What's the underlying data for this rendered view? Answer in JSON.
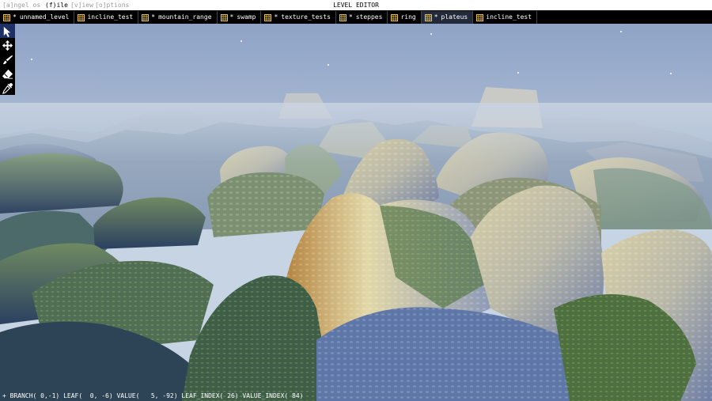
{
  "app": {
    "title": "LEVEL EDITOR"
  },
  "menu": {
    "items": [
      {
        "label": "[a]ngel os",
        "active": false
      },
      {
        "label": "(f)ile",
        "active": true
      },
      {
        "label": "[v]iew",
        "active": false
      },
      {
        "label": "[o]ptions",
        "active": false
      }
    ]
  },
  "tabs": [
    {
      "label": "unnamed_level",
      "dirty": true,
      "active": false
    },
    {
      "label": "incline_test",
      "dirty": false,
      "active": false
    },
    {
      "label": "mountain_range",
      "dirty": true,
      "active": false
    },
    {
      "label": "swamp",
      "dirty": true,
      "active": false
    },
    {
      "label": "texture_tests",
      "dirty": true,
      "active": false
    },
    {
      "label": "steppes",
      "dirty": true,
      "active": false
    },
    {
      "label": "ring",
      "dirty": false,
      "active": false
    },
    {
      "label": "plateus",
      "dirty": true,
      "active": true
    },
    {
      "label": "incline_test",
      "dirty": false,
      "active": false
    }
  ],
  "dirty_marker": "*",
  "tools": [
    {
      "name": "select-tool",
      "icon": "arrow-cursor-icon",
      "active": true
    },
    {
      "name": "move-tool",
      "icon": "move-arrows-icon",
      "active": false
    },
    {
      "name": "brush-tool",
      "icon": "brush-icon",
      "active": false
    },
    {
      "name": "eraser-tool",
      "icon": "eraser-icon",
      "active": false
    },
    {
      "name": "eyedropper-tool",
      "icon": "eyedropper-icon",
      "active": false
    }
  ],
  "status": {
    "text": "+ BRANCH( 0,-1) LEAF(  0, -6) VALUE(   5, -92) LEAF_INDEX( 26) VALUE_INDEX( 84)"
  },
  "colors": {
    "tab_icon": "#e8c24a",
    "active_tab": "#222a3a",
    "active_tool": "#1e2f66",
    "sky_top": "#8fa3c6",
    "sky_horizon": "#c7d4e3"
  }
}
